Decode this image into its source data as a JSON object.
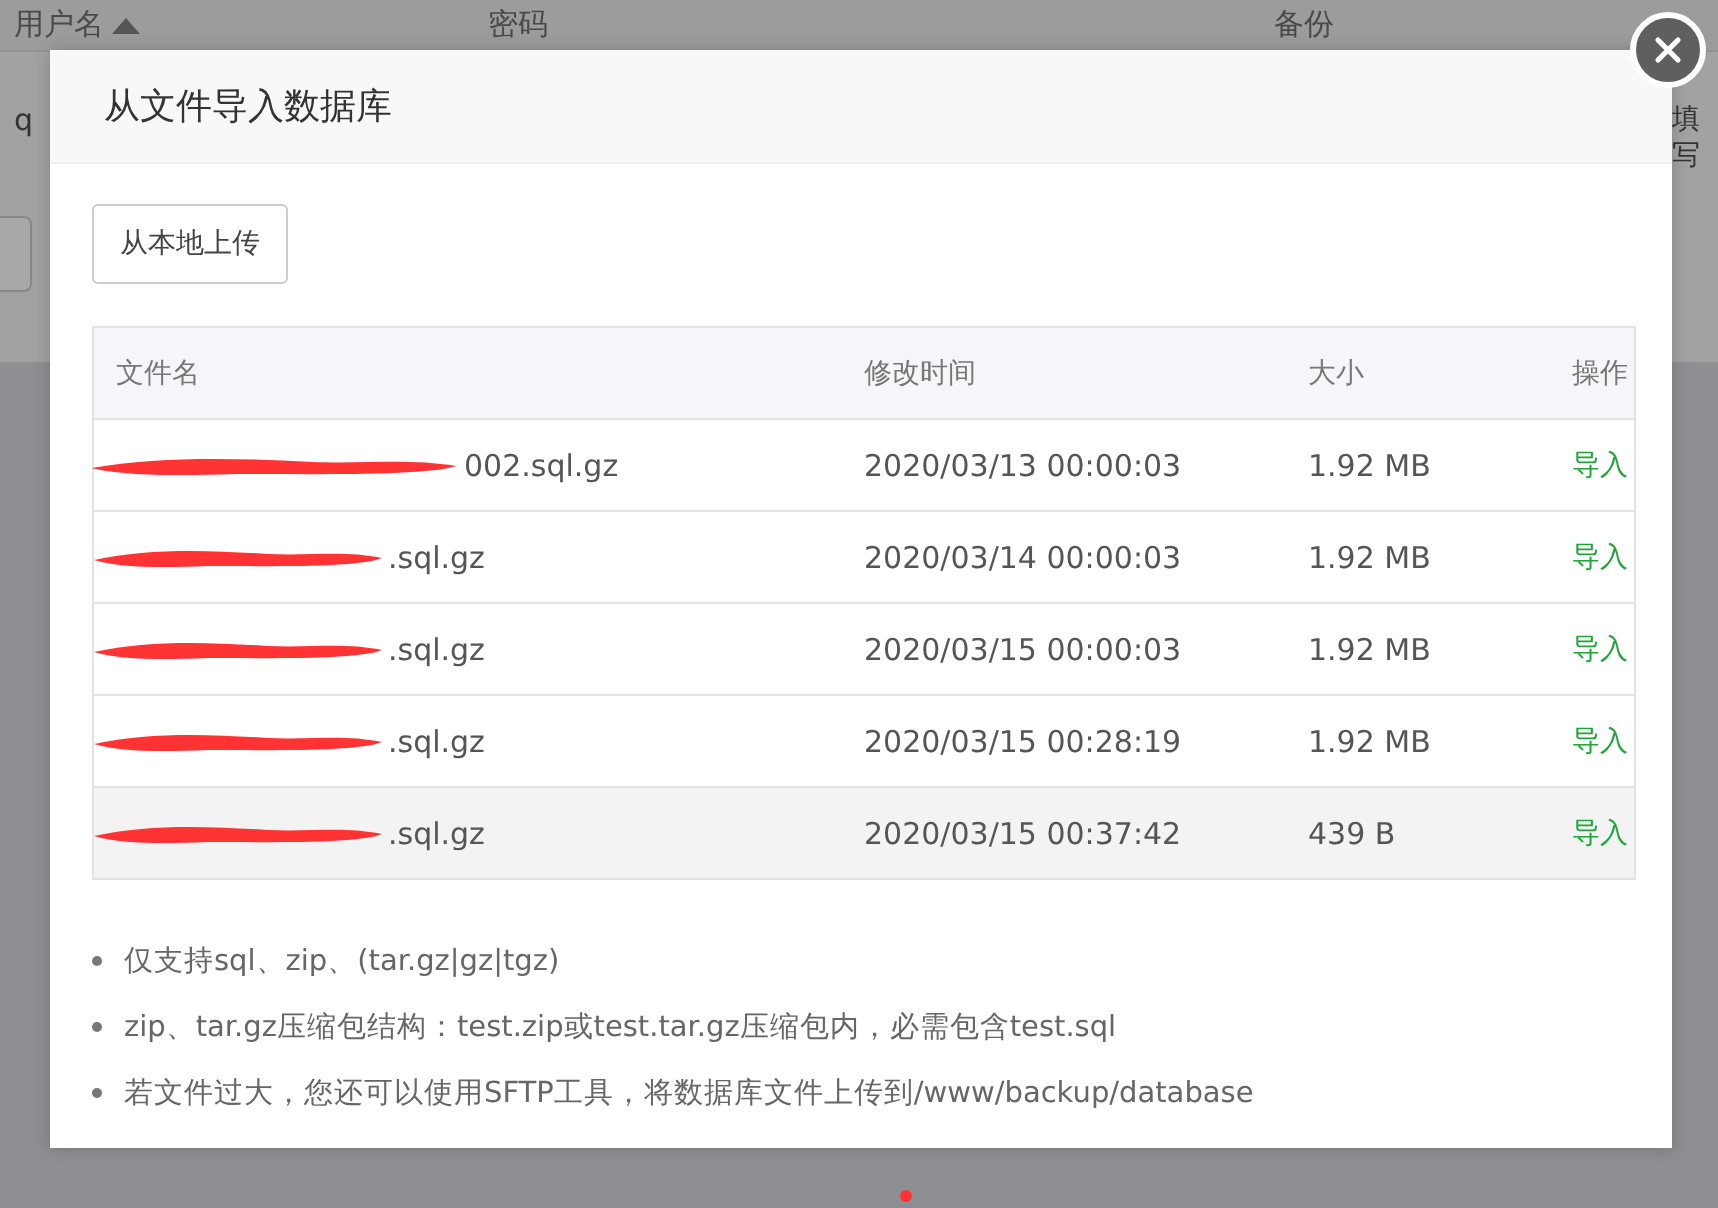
{
  "background_table": {
    "columns": [
      {
        "label": "用户名",
        "sorted": true
      },
      {
        "label": "密码",
        "sorted": false
      },
      {
        "label": "备份",
        "sorted": false
      }
    ],
    "row": {
      "column_1": "q",
      "column_4": "填写"
    }
  },
  "dialog": {
    "title": "从文件导入数据库",
    "upload_button": "从本地上传",
    "table": {
      "columns": [
        "文件名",
        "修改时间",
        "大小",
        "操作"
      ],
      "rows": [
        {
          "filename": "002.sql.gz",
          "redacted": true,
          "modified": "2020/03/13 00:00:03",
          "size": "1.92 MB",
          "action": "导入",
          "highlighted": false
        },
        {
          "filename": ".sql.gz",
          "redacted": true,
          "modified": "2020/03/14 00:00:03",
          "size": "1.92 MB",
          "action": "导入",
          "highlighted": false
        },
        {
          "filename": ".sql.gz",
          "redacted": true,
          "modified": "2020/03/15 00:00:03",
          "size": "1.92 MB",
          "action": "导入",
          "highlighted": false
        },
        {
          "filename": ".sql.gz",
          "redacted": true,
          "modified": "2020/03/15 00:28:19",
          "size": "1.92 MB",
          "action": "导入",
          "highlighted": false
        },
        {
          "filename": ".sql.gz",
          "redacted": true,
          "modified": "2020/03/15 00:37:42",
          "size": "439 B",
          "action": "导入",
          "highlighted": true
        }
      ]
    },
    "notes": [
      "仅支持sql、zip、(tar.gz|gz|tgz)",
      "zip、tar.gz压缩包结构：test.zip或test.tar.gz压缩包内，必需包含test.sql",
      "若文件过大，您还可以使用SFTP工具，将数据库文件上传到/www/backup/database"
    ]
  }
}
